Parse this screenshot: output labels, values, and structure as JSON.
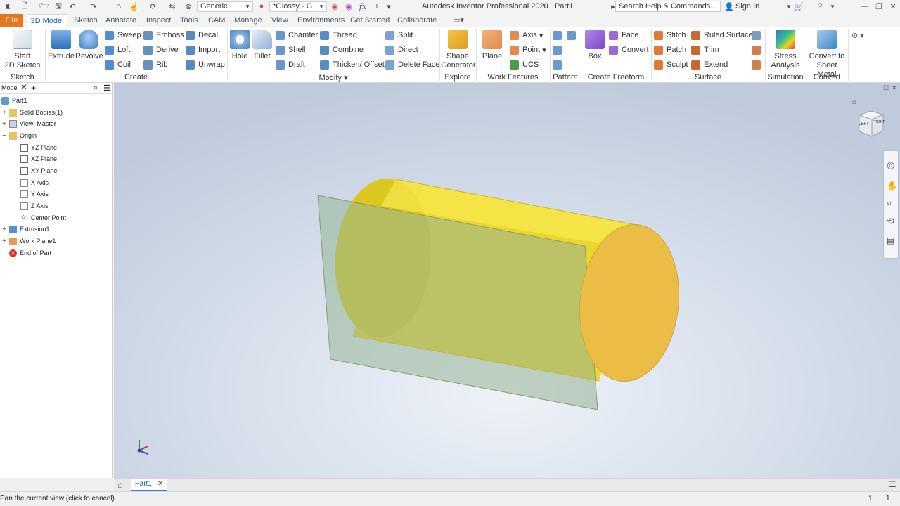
{
  "window": {
    "app_title": "Autodesk Inventor Professional 2020",
    "document_title": "Part1",
    "search_placeholder": "Search Help & Commands...",
    "sign_in": "Sign In"
  },
  "quick_access": {
    "material": "Generic",
    "appearance": "*Glossy - G"
  },
  "tabs": [
    "File",
    "3D Model",
    "Sketch",
    "Annotate",
    "Inspect",
    "Tools",
    "CAM",
    "Manage",
    "View",
    "Environments",
    "Get Started",
    "Collaborate"
  ],
  "ribbon": {
    "sketch": {
      "start_line1": "Start",
      "start_line2": "2D Sketch",
      "label": "Sketch"
    },
    "create": {
      "extrude": "Extrude",
      "revolve": "Revolve",
      "sweep": "Sweep",
      "loft": "Loft",
      "coil": "Coil",
      "emboss": "Emboss",
      "derive": "Derive",
      "rib": "Rib",
      "decal": "Decal",
      "import": "Import",
      "unwrap": "Unwrap",
      "label": "Create"
    },
    "modify": {
      "hole": "Hole",
      "fillet": "Fillet",
      "chamfer": "Chamfer",
      "shell": "Shell",
      "draft": "Draft",
      "thread": "Thread",
      "combine": "Combine",
      "thicken": "Thicken/ Offset",
      "split": "Split",
      "direct": "Direct",
      "delete_face": "Delete Face",
      "label": "Modify"
    },
    "explore": {
      "shape_line1": "Shape",
      "shape_line2": "Generator",
      "label": "Explore"
    },
    "work_features": {
      "plane": "Plane",
      "axis": "Axis",
      "point": "Point",
      "ucs": "UCS",
      "label": "Work Features"
    },
    "pattern": {
      "label": "Pattern"
    },
    "freeform": {
      "box": "Box",
      "face": "Face",
      "convert": "Convert",
      "label": "Create Freeform"
    },
    "surface": {
      "stitch": "Stitch",
      "patch": "Patch",
      "sculpt": "Sculpt",
      "ruled": "Ruled Surface",
      "trim": "Trim",
      "extend": "Extend",
      "label": "Surface"
    },
    "simulation": {
      "stress_line1": "Stress",
      "stress_line2": "Analysis",
      "label": "Simulation"
    },
    "convert": {
      "sheet_line1": "Convert to",
      "sheet_line2": "Sheet Metal",
      "label": "Convert"
    }
  },
  "browser": {
    "tab": "Model",
    "items": [
      {
        "label": "Part1"
      },
      {
        "label": "Solid Bodies(1)"
      },
      {
        "label": "View: Master"
      },
      {
        "label": "Origin"
      },
      {
        "label": "YZ Plane"
      },
      {
        "label": "XZ Plane"
      },
      {
        "label": "XY Plane"
      },
      {
        "label": "X Axis"
      },
      {
        "label": "Y Axis"
      },
      {
        "label": "Z Axis"
      },
      {
        "label": "Center Point"
      },
      {
        "label": "Extrusion1"
      },
      {
        "label": "Work Plane1"
      },
      {
        "label": "End of Part"
      }
    ]
  },
  "viewcube": {
    "left": "LEFT",
    "front": "FRONT"
  },
  "doc_tabs": {
    "active": "Part1"
  },
  "status": {
    "message": "Pan the current view (click to cancel)",
    "count1": "1",
    "count2": "1"
  }
}
